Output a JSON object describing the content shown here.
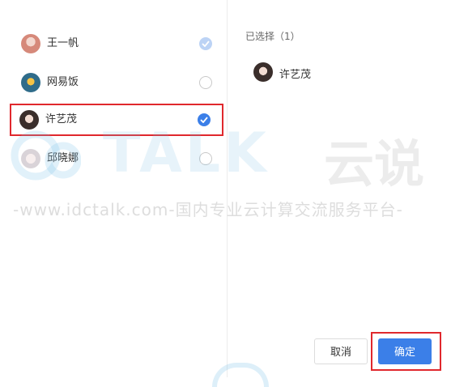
{
  "members": [
    {
      "name": "王一帆",
      "state": "checked-disabled",
      "avatar": "avatar-pink-person"
    },
    {
      "name": "网易饭",
      "state": "unchecked",
      "avatar": "avatar-cartoon"
    },
    {
      "name": "许艺茂",
      "state": "checked",
      "avatar": "avatar-dark-hair-person"
    },
    {
      "name": "邱晓娜",
      "state": "unchecked",
      "avatar": "avatar-light-person"
    }
  ],
  "selected": {
    "title": "已选择（1）",
    "items": [
      {
        "name": "许艺茂",
        "avatar": "avatar-dark-hair-person"
      }
    ]
  },
  "buttons": {
    "cancel": "取消",
    "confirm": "确定"
  },
  "watermark": {
    "brand": "TALK",
    "brand_cn": "云说",
    "line": "-www.idctalk.com-国内专业云计算交流服务平台-"
  },
  "colors": {
    "accent": "#3b7fe8",
    "highlight_border": "#e0282d",
    "disabled_check": "#bcd3f5"
  }
}
